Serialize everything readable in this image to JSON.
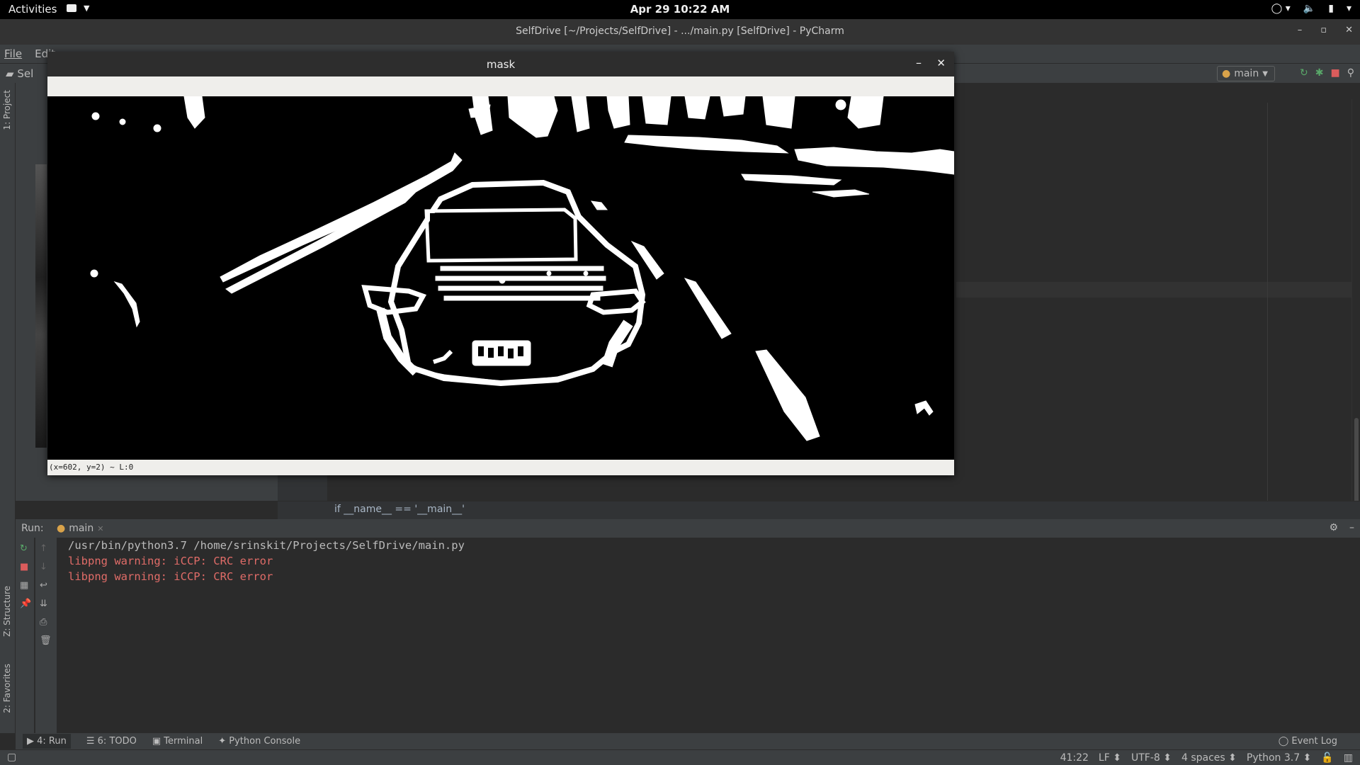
{
  "topbar": {
    "activities": "Activities",
    "clock": "Apr 29  10:22 AM"
  },
  "window": {
    "title": "SelfDrive [~/Projects/SelfDrive] - .../main.py [SelfDrive] - PyCharm"
  },
  "menubar": {
    "items": [
      "File",
      "Edit"
    ]
  },
  "navbar": {
    "project": "Sel",
    "run_config": "main"
  },
  "sidebar": {
    "project_tab": "1: Project",
    "structure_tab": "Z: Structure",
    "favorites_tab": "2: Favorites"
  },
  "editor": {
    "code_line": "if __name__ == '__main__'"
  },
  "mask_window": {
    "title": "mask",
    "status": "(x=602, y=2) ~ L:0"
  },
  "run": {
    "label": "Run:",
    "tab": "main",
    "lines": [
      {
        "text": "/usr/bin/python3.7 /home/srinskit/Projects/SelfDrive/main.py",
        "kind": "cmd"
      },
      {
        "text": "libpng warning: iCCP: CRC error",
        "kind": "err"
      },
      {
        "text": "libpng warning: iCCP: CRC error",
        "kind": "err"
      }
    ]
  },
  "bottom_tabs": {
    "run": "4: Run",
    "todo": "6: TODO",
    "terminal": "Terminal",
    "python_console": "Python Console",
    "event_log": "Event Log"
  },
  "statusbar": {
    "position": "41:22",
    "line_sep": "LF",
    "encoding": "UTF-8",
    "indent": "4 spaces",
    "interpreter": "Python 3.7"
  },
  "colors": {
    "error_text": "#e06c68",
    "ide_bg": "#2b2b2b",
    "panel_bg": "#3c3f41"
  }
}
